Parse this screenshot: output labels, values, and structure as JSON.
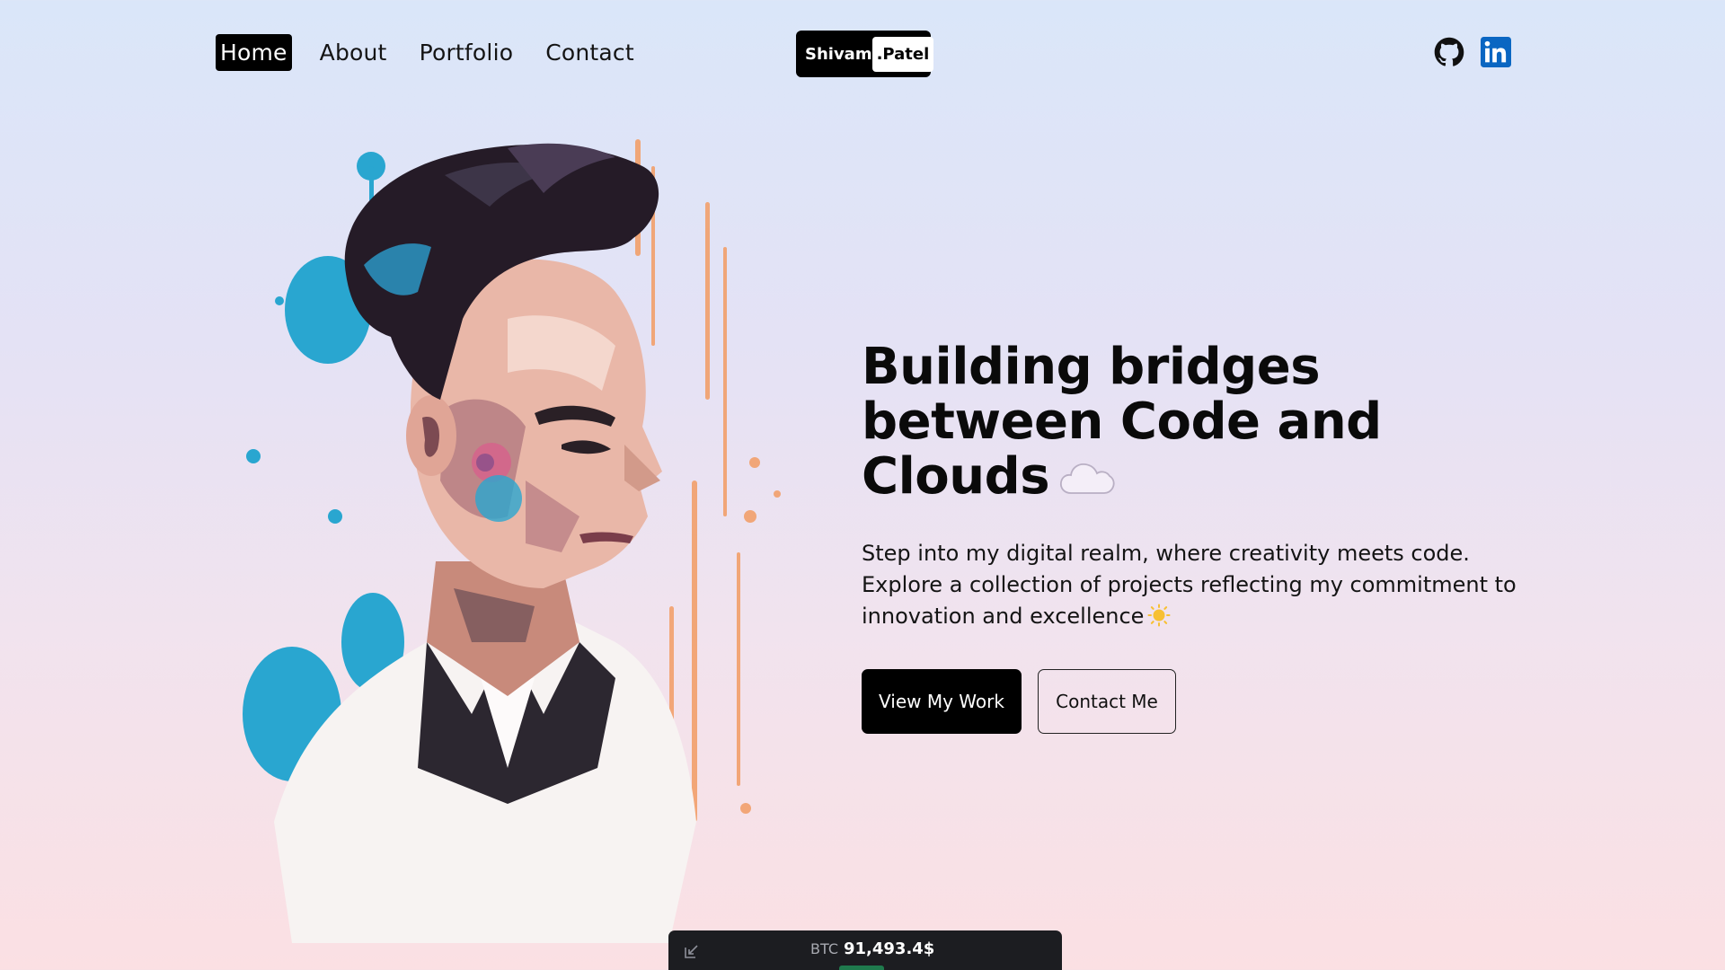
{
  "nav": {
    "items": [
      {
        "label": "Home",
        "active": true
      },
      {
        "label": "About",
        "active": false
      },
      {
        "label": "Portfolio",
        "active": false
      },
      {
        "label": "Contact",
        "active": false
      }
    ]
  },
  "logo": {
    "first": "Shivam",
    "last": ".Patel"
  },
  "socials": [
    {
      "icon": "github-icon"
    },
    {
      "icon": "linkedin-icon",
      "color": "#0a66c2"
    }
  ],
  "hero": {
    "title": "Building bridges between Code and Clouds",
    "title_icon": "cloud-icon",
    "description": "Step into my digital realm, where creativity meets code. Explore a collection of projects reflecting my commitment to innovation and excellence",
    "description_icon": "sun-icon",
    "primary_button": "View My Work",
    "secondary_button": "Contact Me",
    "illustration": "watercolor-splash-portrait"
  },
  "ticker": {
    "symbol": "BTC",
    "price": "91,493.4$",
    "toggle_icon": "minimize-arrow-icon",
    "trend_color": "#1f7a4d"
  },
  "colors": {
    "accent": "#000000",
    "background_top": "#dae6f9",
    "background_bottom": "#fbe0e3",
    "linkedin": "#0a66c2"
  }
}
